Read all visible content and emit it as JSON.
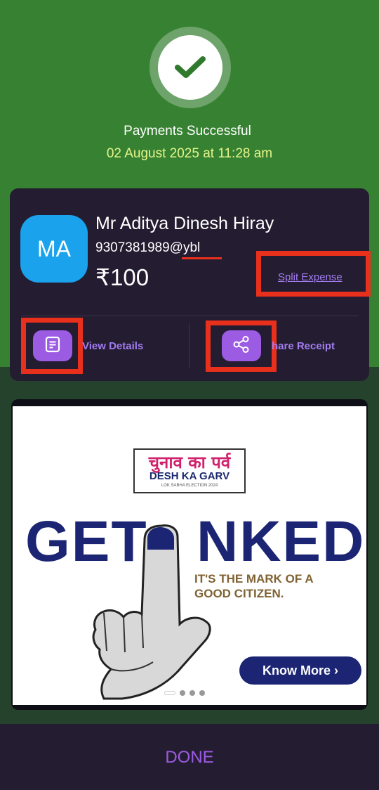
{
  "status": {
    "title": "Payments Successful",
    "date": "02 August 2025 at 11:28 am"
  },
  "payee": {
    "initials": "MA",
    "name": "Mr Aditya Dinesh Hiray",
    "upi_id": "9307381989@ybl",
    "amount": "₹100",
    "split_label": "Split Expense"
  },
  "actions": {
    "view_details": "View Details",
    "share_receipt": "hare Receipt"
  },
  "banner": {
    "logo_hindi": "चुनाव का पर्व",
    "logo_english": "DESH KA GARV",
    "logo_sub": "LOK SABHA ELECTION 2024",
    "headline_left": "GET",
    "headline_right": "NKED",
    "tagline_1": "IT'S THE MARK OF A",
    "tagline_2": "GOOD CITIZEN.",
    "cta": "Know More ›",
    "slide_count": 4,
    "active_slide": 1
  },
  "footer": {
    "done_label": "DONE"
  },
  "colors": {
    "success_green": "#378232",
    "card_bg": "#241d31",
    "accent_purple": "#9c5be3",
    "avatar_blue": "#1aa3ec",
    "highlight_red": "#e8301c"
  }
}
